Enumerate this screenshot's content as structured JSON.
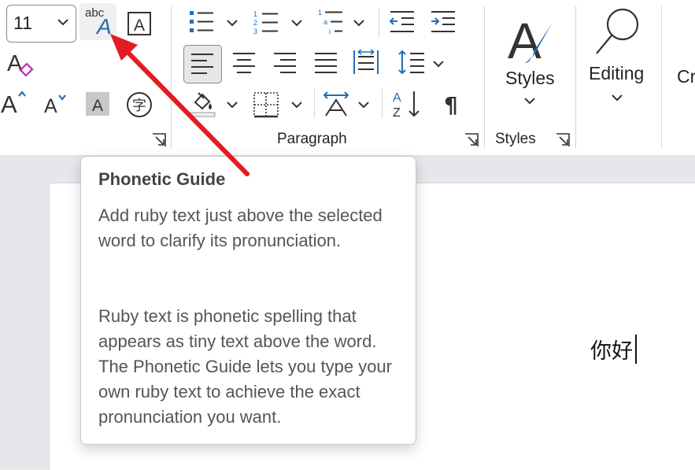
{
  "font": {
    "size_value": "11"
  },
  "paragraph": {
    "group_label": "Paragraph"
  },
  "styles": {
    "button_label": "Styles",
    "group_label": "Styles"
  },
  "editing": {
    "button_label": "Editing"
  },
  "cut_off_label": "Cr",
  "tooltip": {
    "title": "Phonetic Guide",
    "paragraph1": "Add ruby text just above the selected word to clarify its pronunciation.",
    "paragraph2": "Ruby text is phonetic spelling that appears as tiny text above the word. The Phonetic Guide lets you type your own ruby text to achieve the exact pronunciation you want."
  },
  "document": {
    "text": "你好"
  },
  "icons": {
    "phonetic_guide": "phonetic-guide-icon",
    "character_border": "character-border-icon",
    "clear_formatting": "clear-formatting-icon",
    "grow_font": "grow-font-icon",
    "shrink_font": "shrink-font-icon",
    "character_shading": "character-shading-icon",
    "enclose_characters": "enclose-characters-icon"
  },
  "colors": {
    "accent": "#1f6fb5",
    "arrow": "#e31b23",
    "ribbon": "#ffffff",
    "workspace": "#e8e6ec"
  }
}
